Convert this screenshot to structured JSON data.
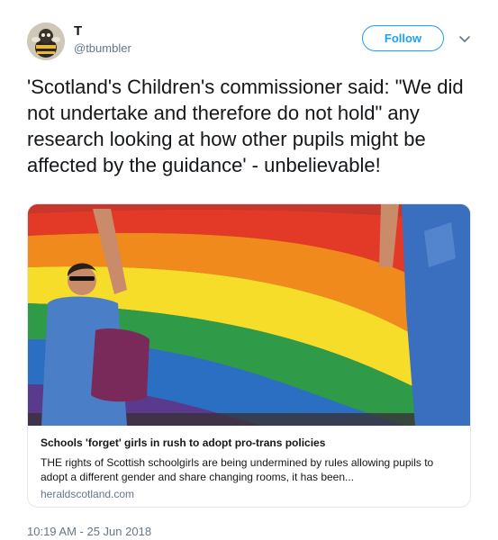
{
  "author": {
    "name": "T",
    "handle": "@tbumbler",
    "avatar_icon": "bumblebee-avatar-icon"
  },
  "follow_button": {
    "label": "Follow",
    "color": "#1da1f2"
  },
  "menu_icon": "chevron-down-icon",
  "tweet": {
    "text": "'Scotland's Children's commissioner said: \"We did not undertake and therefore do not hold\" any research looking at how other pupils might be affected by the guidance' - unbelievable!"
  },
  "card": {
    "image_icon": "rainbow-flag-photo",
    "title": "Schools 'forget' girls in rush to adopt pro-trans policies",
    "description": "THE rights of Scottish schoolgirls are being undermined by rules allowing pupils to adopt a different gender and share changing rooms, it has been...",
    "domain": "heraldscotland.com"
  },
  "timestamp": "10:19 AM - 25 Jun 2018",
  "colors": {
    "text_primary": "#14171a",
    "text_secondary": "#657786",
    "accent": "#1da1f2",
    "border": "#e1e8ed"
  }
}
